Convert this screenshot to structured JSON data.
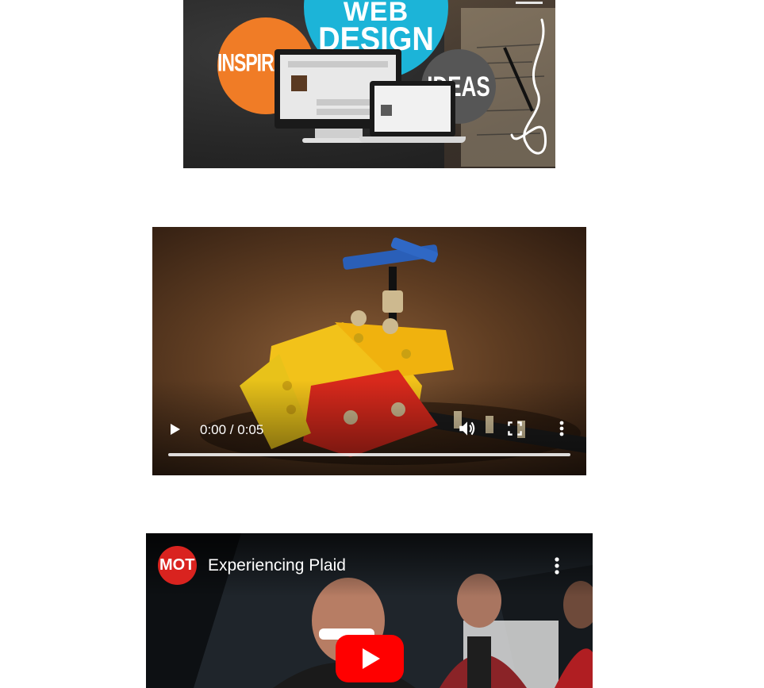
{
  "banner": {
    "line1": "WEB",
    "line2": "DESIGN",
    "left_circle": "INSPIRATION",
    "right_circle": "IDEAS",
    "colors": {
      "design_circle": "#1cb4d8",
      "inspiration_circle": "#f07c26",
      "ideas_circle": "#565656"
    }
  },
  "video_player": {
    "timecode": "0:00 / 0:05",
    "progress": 0,
    "icons": [
      "play-icon",
      "volume-icon",
      "fullscreen-icon",
      "more-vert-icon"
    ]
  },
  "youtube_embed": {
    "channel_logo_text": "MOT",
    "title": "Experiencing Plaid",
    "colors": {
      "logo": "#d9231f",
      "play_button": "#ff0000"
    },
    "icons": [
      "more-vert-icon",
      "youtube-play-icon"
    ]
  }
}
